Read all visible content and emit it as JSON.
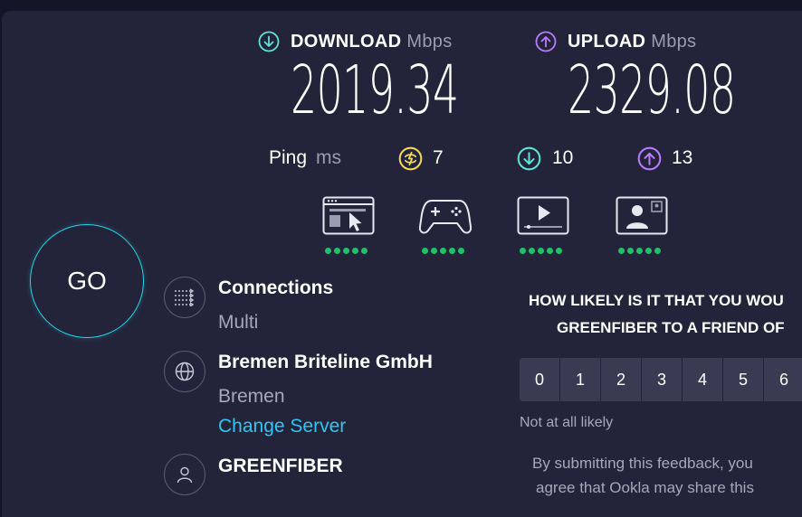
{
  "download": {
    "label": "DOWNLOAD",
    "unit": "Mbps",
    "value": "2019.34",
    "color": "#5fe3d6"
  },
  "upload": {
    "label": "UPLOAD",
    "unit": "Mbps",
    "value": "2329.08",
    "color": "#b97bff"
  },
  "ping": {
    "label": "Ping",
    "unit": "ms",
    "idle": "7",
    "download": "10",
    "upload": "13",
    "idle_color": "#f2d957"
  },
  "quality": [
    {
      "icon": "browsing-icon",
      "rating": 5
    },
    {
      "icon": "gaming-icon",
      "rating": 5
    },
    {
      "icon": "video-streaming-icon",
      "rating": 5
    },
    {
      "icon": "video-chat-icon",
      "rating": 5
    }
  ],
  "go": {
    "label": "GO"
  },
  "connections": {
    "title": "Connections",
    "value": "Multi"
  },
  "server": {
    "name": "Bremen Briteline GmbH",
    "location": "Bremen",
    "change_label": "Change Server"
  },
  "provider": {
    "name": "GREENFIBER"
  },
  "survey": {
    "question_line1": "HOW LIKELY IS IT THAT YOU WOU",
    "question_line2": "GREENFIBER TO A FRIEND OF",
    "scale": [
      "0",
      "1",
      "2",
      "3",
      "4",
      "5",
      "6"
    ],
    "low_hint": "Not at all likely",
    "notice_line1": "By submitting this feedback, you",
    "notice_line2": "agree that Ookla may share this"
  },
  "accent": "#27d4e6",
  "good_color": "#1fc16b"
}
